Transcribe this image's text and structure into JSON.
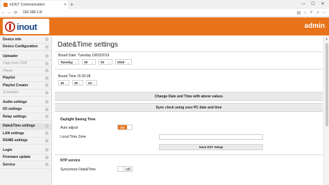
{
  "browser": {
    "tab_title": "inOUT Communication",
    "tab_close": "✕",
    "new_tab": "+",
    "url": "192.168.1.5/",
    "back": "←",
    "forward": "→",
    "reload": "⟳",
    "min": "—",
    "max": "☐",
    "close": "✕"
  },
  "header": {
    "logo_text": "inout",
    "user": "admin"
  },
  "sidebar": {
    "items": [
      {
        "label": "Device info",
        "disabled": false
      },
      {
        "label": "Device Configuration",
        "disabled": false
      },
      {
        "gap": true
      },
      {
        "label": "Uploader",
        "disabled": false
      },
      {
        "label": "Copy from USB",
        "disabled": true
      },
      {
        "label": "Player",
        "disabled": true
      },
      {
        "label": "Playlist",
        "disabled": false
      },
      {
        "label": "Playlist Creator",
        "disabled": false
      },
      {
        "label": "Scheduler",
        "disabled": true
      },
      {
        "gap": true
      },
      {
        "label": "Audio settings",
        "disabled": false
      },
      {
        "label": "I/O settings",
        "disabled": false
      },
      {
        "label": "Relay settings",
        "disabled": false
      },
      {
        "gap": true
      },
      {
        "label": "Date&Time settings",
        "disabled": false,
        "active": true
      },
      {
        "label": "LAN settings",
        "disabled": false
      },
      {
        "label": "RS485 settings",
        "disabled": false
      },
      {
        "gap": true
      },
      {
        "label": "Login",
        "disabled": false
      },
      {
        "label": "Firmware update",
        "disabled": false
      },
      {
        "label": "Service",
        "disabled": false
      }
    ]
  },
  "main": {
    "title": "Date&Time settings",
    "board_date": "Board Date: Tuesday 19/03/2019",
    "date_fields": [
      "Tuesday",
      "19",
      "03",
      "2019"
    ],
    "board_time": "Board Time 15:30:28",
    "time_fields": [
      "15",
      "30",
      "23"
    ],
    "change_btn": "Change Date and Time with above values",
    "sync_btn": "Sync clock using your PC date and time",
    "dst_title": "Daylight Saving Time",
    "auto_adjust_label": "Auto adjust",
    "auto_adjust_value": "On",
    "local_tz_label": "Local Time Zone",
    "dst_save_btn": "Save DST Setup",
    "ntp_title": "NTP service",
    "sync_label": "Syncronize Date&Time",
    "sync_value": "Off"
  }
}
